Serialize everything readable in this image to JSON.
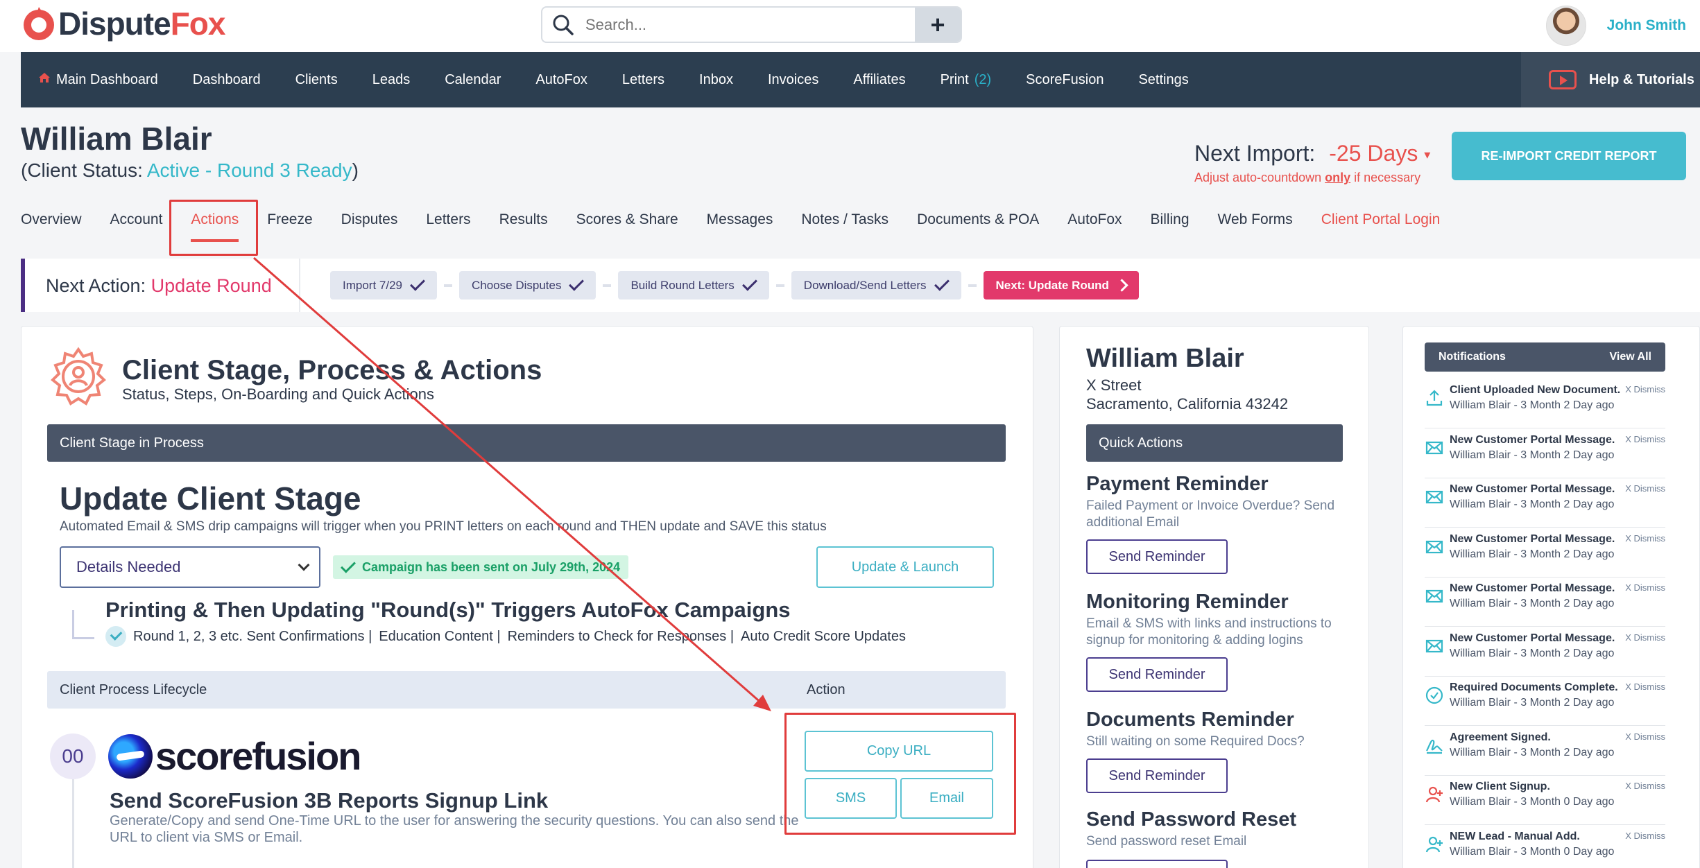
{
  "header": {
    "logo_a": "Dispute",
    "logo_b": "Fox",
    "search_placeholder": "Search...",
    "add_symbol": "+",
    "user_name": "John Smith"
  },
  "nav": {
    "items": [
      {
        "label": "Main Dashboard",
        "home": true
      },
      {
        "label": "Dashboard"
      },
      {
        "label": "Clients"
      },
      {
        "label": "Leads"
      },
      {
        "label": "Calendar"
      },
      {
        "label": "AutoFox"
      },
      {
        "label": "Letters"
      },
      {
        "label": "Inbox"
      },
      {
        "label": "Invoices"
      },
      {
        "label": "Affiliates"
      },
      {
        "label": "Print",
        "badge": "(2)"
      },
      {
        "label": "ScoreFusion"
      },
      {
        "label": "Settings"
      }
    ],
    "help": "Help & Tutorials"
  },
  "client": {
    "name": "William Blair",
    "status_prefix": "(Client Status:",
    "status": "Active - Round 3 Ready",
    "status_suffix": ")"
  },
  "import": {
    "label": "Next Import:",
    "days": "-25 Days",
    "adjust_a": "Adjust auto-countdown ",
    "adjust_b": "only",
    "adjust_c": " if necessary",
    "button": "RE-IMPORT CREDIT REPORT"
  },
  "tabs": [
    "Overview",
    "Account",
    "Actions",
    "Freeze",
    "Disputes",
    "Letters",
    "Results",
    "Scores & Share",
    "Messages",
    "Notes / Tasks",
    "Documents & POA",
    "AutoFox",
    "Billing",
    "Web Forms",
    "Client Portal Login"
  ],
  "next_action": {
    "label": "Next Action:",
    "value": "Update Round",
    "steps": [
      "Import 7/29",
      "Choose Disputes",
      "Build Round Letters",
      "Download/Send Letters"
    ],
    "next_step": "Next: Update Round"
  },
  "main": {
    "title": "Client Stage, Process & Actions",
    "subtitle": "Status, Steps, On-Boarding and Quick Actions",
    "stage_bar": "Client Stage in Process",
    "update_title": "Update Client Stage",
    "update_sub": "Automated Email & SMS drip campaigns will trigger when you PRINT letters on each round and THEN update and SAVE this status",
    "select_value": "Details Needed",
    "campaign": "Campaign has been sent on July 29th, 2024",
    "update_button": "Update & Launch",
    "trigger_title": "Printing & Then Updating \"Round(s)\" Triggers AutoFox Campaigns",
    "trigger_items": [
      "Round 1, 2, 3 etc. Sent Confirmations  |",
      "Education Content  |",
      "Reminders to Check for Responses  |",
      "Auto Credit Score Updates"
    ],
    "lifecycle": "Client Process Lifecycle",
    "action": "Action",
    "step_num": "00",
    "scorefusion": "scorefusion",
    "send_title": "Send ScoreFusion 3B Reports Signup Link",
    "send_sub": "Generate/Copy and send One-Time URL to the user for answering the security questions. You can also send the URL to client via SMS or Email.",
    "copy_url": "Copy URL",
    "sms": "SMS",
    "email": "Email"
  },
  "side": {
    "name": "William Blair",
    "street": "X Street",
    "city": "Sacramento, California 43242",
    "quick_actions": "Quick Actions",
    "actions": [
      {
        "title": "Payment Reminder",
        "sub": "Failed Payment or Invoice Overdue? Send additional Email",
        "button": "Send Reminder"
      },
      {
        "title": "Monitoring Reminder",
        "sub": "Email & SMS with links and instructions to signup for monitoring & adding logins",
        "button": "Send Reminder"
      },
      {
        "title": "Documents Reminder",
        "sub": "Still waiting on some Required Docs?",
        "button": "Send Reminder"
      },
      {
        "title": "Send Password Reset",
        "sub": "Send password reset Email",
        "button": ""
      }
    ]
  },
  "notifications": {
    "title": "Notifications",
    "view_all": "View All",
    "dismiss": "X Dismiss",
    "items": [
      {
        "icon": "upload-icon",
        "title": "Client Uploaded New Document.",
        "sub": "William Blair - 3 Month 2 Day ago"
      },
      {
        "icon": "mail-icon",
        "title": "New Customer Portal Message.",
        "sub": "William Blair - 3 Month 2 Day ago"
      },
      {
        "icon": "mail-icon",
        "title": "New Customer Portal Message.",
        "sub": "William Blair - 3 Month 2 Day ago"
      },
      {
        "icon": "mail-icon",
        "title": "New Customer Portal Message.",
        "sub": "William Blair - 3 Month 2 Day ago"
      },
      {
        "icon": "mail-icon",
        "title": "New Customer Portal Message.",
        "sub": "William Blair - 3 Month 2 Day ago"
      },
      {
        "icon": "mail-icon",
        "title": "New Customer Portal Message.",
        "sub": "William Blair - 3 Month 2 Day ago"
      },
      {
        "icon": "check-circle-icon",
        "title": "Required Documents Complete.",
        "sub": "William Blair - 3 Month 2 Day ago"
      },
      {
        "icon": "signature-icon",
        "title": "Agreement Signed.",
        "sub": "William Blair - 3 Month 2 Day ago"
      },
      {
        "icon": "user-add-icon",
        "title": "New Client Signup.",
        "sub": "William Blair - 3 Month 0 Day ago"
      },
      {
        "icon": "user-add-icon",
        "title": "NEW Lead - Manual Add.",
        "sub": "William Blair - 3 Month 0 Day ago"
      }
    ]
  },
  "colors": {
    "brand": "#e8514d",
    "nav": "#2c3e50",
    "accent": "#46bccf",
    "highlight": "#e03c3c"
  }
}
